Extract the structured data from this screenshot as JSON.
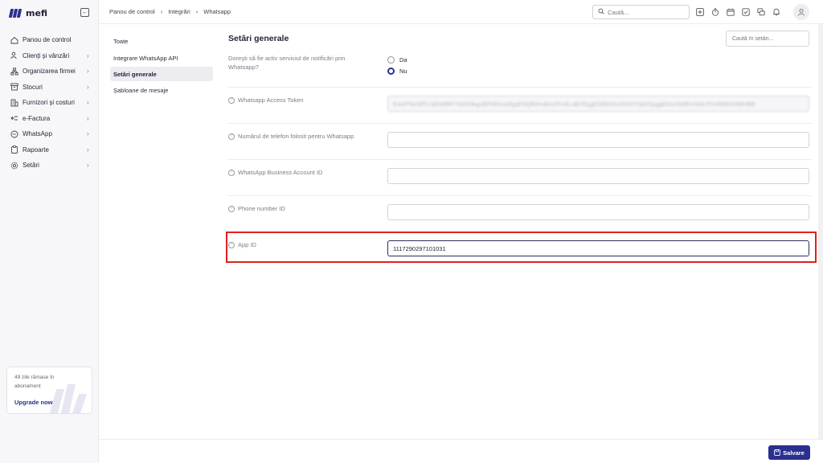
{
  "brand": {
    "name": "mefi"
  },
  "sidebar": {
    "items": [
      {
        "label": "Panou de control",
        "icon": "home-icon",
        "chevron": false
      },
      {
        "label": "Clienți și vânzări",
        "icon": "users-icon",
        "chevron": true
      },
      {
        "label": "Organizarea firmei",
        "icon": "org-chart-icon",
        "chevron": true
      },
      {
        "label": "Stocuri",
        "icon": "box-icon",
        "chevron": true
      },
      {
        "label": "Furnizori și costuri",
        "icon": "building-icon",
        "chevron": true
      },
      {
        "label": "e-Factura",
        "icon": "efactura-icon",
        "chevron": true
      },
      {
        "label": "WhatsApp",
        "icon": "chat-icon",
        "chevron": true
      },
      {
        "label": "Rapoarte",
        "icon": "clipboard-icon",
        "chevron": true
      },
      {
        "label": "Setări",
        "icon": "gear-icon",
        "chevron": true
      }
    ],
    "upgrade": {
      "text": "49 zile rămase în abonament",
      "link": "Upgrade now"
    }
  },
  "topbar": {
    "breadcrumb": [
      "Panou de control",
      "Integrări",
      "Whatsapp"
    ],
    "search_placeholder": "Caută..."
  },
  "subnav": {
    "items": [
      {
        "label": "Toate",
        "active": false
      },
      {
        "label": "Integrare WhatsApp API",
        "active": false
      },
      {
        "label": "Setări generale",
        "active": true
      },
      {
        "label": "Șabloane de mesaje",
        "active": false
      }
    ]
  },
  "main": {
    "title": "Setări generale",
    "search_placeholder": "Caută în setări...",
    "notify_question": "Doreşti să fie activ serviciul de notificări prin Whatsapp?",
    "radio_yes": "Da",
    "radio_no": "Nu",
    "selected": "Nu",
    "fields": {
      "token_label": "Whatsapp Access Token",
      "token_value": "EAAPWz9fTLsBO9f8F7GDh8kgsBPhRkvzMgqFhQB9mdKeZFnrlLuBCEqgEDBGKkcRXdYOp0Spgg8ZeeXbBFmWA7FmRb6h0ABHBB",
      "phone_label": "Numărul de telefon folosit pentru Whatsapp",
      "phone_value": "",
      "waba_label": "WhatsApp Business Account ID",
      "waba_value": "",
      "phone_id_label": "Phone number ID",
      "phone_id_value": "",
      "app_id_label": "App ID",
      "app_id_value": "1117290297101031"
    }
  },
  "footer": {
    "save_label": "Salvare"
  },
  "colors": {
    "accent": "#2b2f8f",
    "highlight": "#e02020"
  }
}
